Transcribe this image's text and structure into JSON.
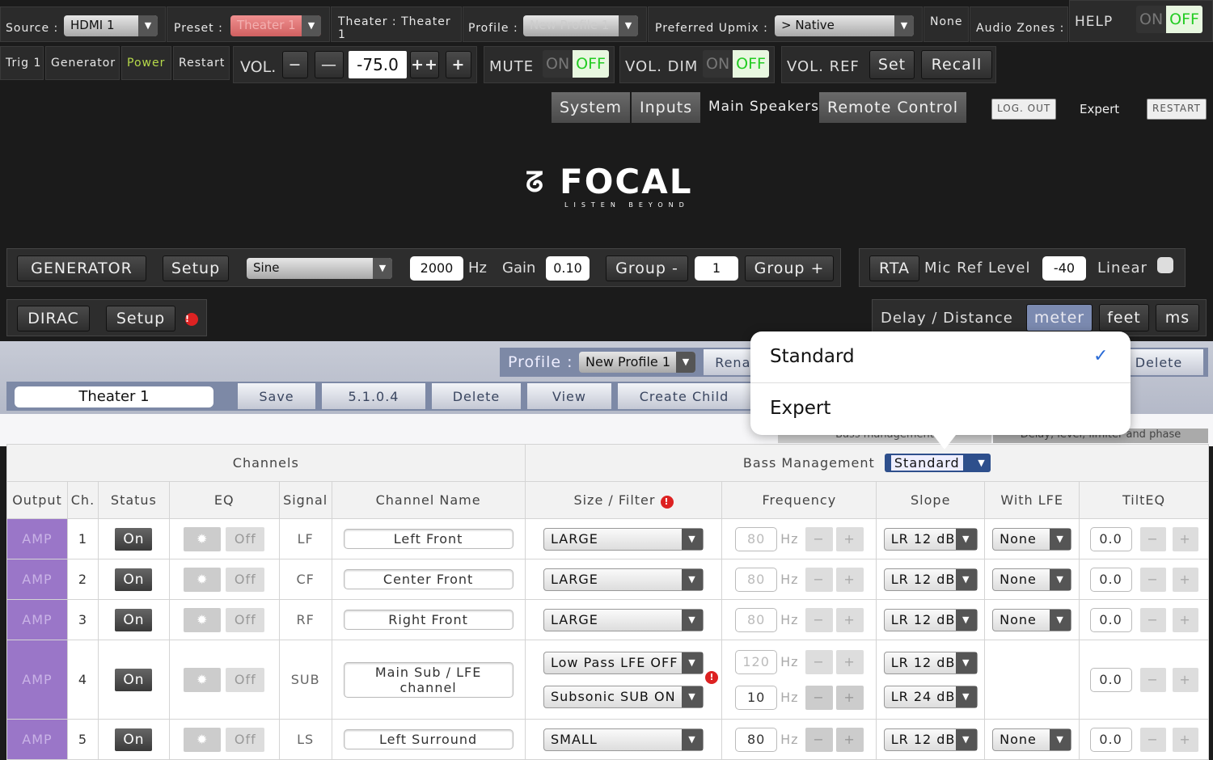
{
  "top": {
    "source_label": "Source :",
    "source": "HDMI 1",
    "preset_label": "Preset :",
    "preset": "Theater 1",
    "theater": "Theater : Theater 1",
    "profile_label": "Profile :",
    "profile": "New Profile 1",
    "upmix_label": "Preferred Upmix :",
    "upmix": "> Native",
    "none": "None",
    "zones": "Audio Zones :",
    "help": "HELP",
    "on": "ON",
    "off": "OFF"
  },
  "row2": {
    "trig": "Trig 1",
    "generator": "Generator",
    "power": "Power",
    "restart": "Restart",
    "vol": "VOL.",
    "vol_minus": "−",
    "vol_minus2": "—",
    "vol_value": "-75.0",
    "vol_plus2": "++",
    "vol_plus": "+",
    "mute": "MUTE",
    "voldim": "VOL. DIM",
    "volref": "VOL. REF",
    "set": "Set",
    "recall": "Recall",
    "on": "ON",
    "off": "OFF"
  },
  "tabs": [
    {
      "label": "System"
    },
    {
      "label": "Inputs"
    },
    {
      "label": "Main Speakers"
    },
    {
      "label": "Remote Control"
    }
  ],
  "actions": {
    "logout": "LOG. OUT",
    "expert": "Expert",
    "restart": "RESTART"
  },
  "logo": {
    "brand": "FOCAL",
    "tagline": "LISTEN BEYOND"
  },
  "gen": {
    "generator": "GENERATOR",
    "setup": "Setup",
    "signal": "Sine",
    "freq": "2000",
    "hz": "Hz",
    "gain_label": "Gain",
    "gain": "0.10",
    "group_minus": "Group -",
    "group": "1",
    "group_plus": "Group +",
    "rta": "RTA",
    "mic_label": "Mic Ref Level",
    "mic": "-40",
    "linear": "Linear"
  },
  "dirac": {
    "dirac": "DIRAC",
    "setup": "Setup",
    "delay_label": "Delay / Distance",
    "meter": "meter",
    "feet": "feet",
    "ms": "ms"
  },
  "profilebar": {
    "label": "Profile :",
    "value": "New Profile 1",
    "rename": "Rename",
    "delete": "Delete"
  },
  "theaterbar": {
    "name": "Theater 1",
    "save": "Save",
    "format": "5.1.0.4",
    "delete": "Delete",
    "view": "View",
    "create_child": "Create Child"
  },
  "subtabs": {
    "bass": "Bass management",
    "delay": "Delay, level, limiter and phase"
  },
  "popup": {
    "options": [
      {
        "label": "Standard",
        "selected": true
      },
      {
        "label": "Expert"
      }
    ],
    "check": "✓"
  },
  "table": {
    "channels": "Channels",
    "bass": "Bass Management",
    "bass_mode": "Standard",
    "headers": [
      "Output",
      "Ch.",
      "Status",
      "EQ",
      "Signal",
      "Channel Name",
      "Size / Filter",
      "Frequency",
      "Slope",
      "With LFE",
      "TiltEQ"
    ],
    "hz": "Hz",
    "off": "Off",
    "rows": [
      {
        "output": "AMP",
        "ch": "1",
        "status": "On",
        "signal": "LF",
        "name": "Left Front",
        "size": "LARGE",
        "freq": "80",
        "slope": "LR 12 dB",
        "lfe": "None",
        "tilt": "0.0"
      },
      {
        "output": "AMP",
        "ch": "2",
        "status": "On",
        "signal": "CF",
        "name": "Center Front",
        "size": "LARGE",
        "freq": "80",
        "slope": "LR 12 dB",
        "lfe": "None",
        "tilt": "0.0"
      },
      {
        "output": "AMP",
        "ch": "3",
        "status": "On",
        "signal": "RF",
        "name": "Right Front",
        "size": "LARGE",
        "freq": "80",
        "slope": "LR 12 dB",
        "lfe": "None",
        "tilt": "0.0"
      },
      {
        "output": "AMP",
        "ch": "4",
        "status": "On",
        "signal": "SUB",
        "name": "Main Sub / LFE channel",
        "size": "Low Pass LFE OFF",
        "size2": "Subsonic SUB ON",
        "freq": "120",
        "freq2": "10",
        "slope": "LR 12 dB",
        "slope2": "LR 24 dB",
        "tilt": "0.0"
      },
      {
        "output": "AMP",
        "ch": "5",
        "status": "On",
        "signal": "LS",
        "name": "Left Surround",
        "size": "SMALL",
        "freq": "80",
        "slope": "LR 12 dB",
        "lfe": "None",
        "tilt": "0.0"
      }
    ]
  }
}
